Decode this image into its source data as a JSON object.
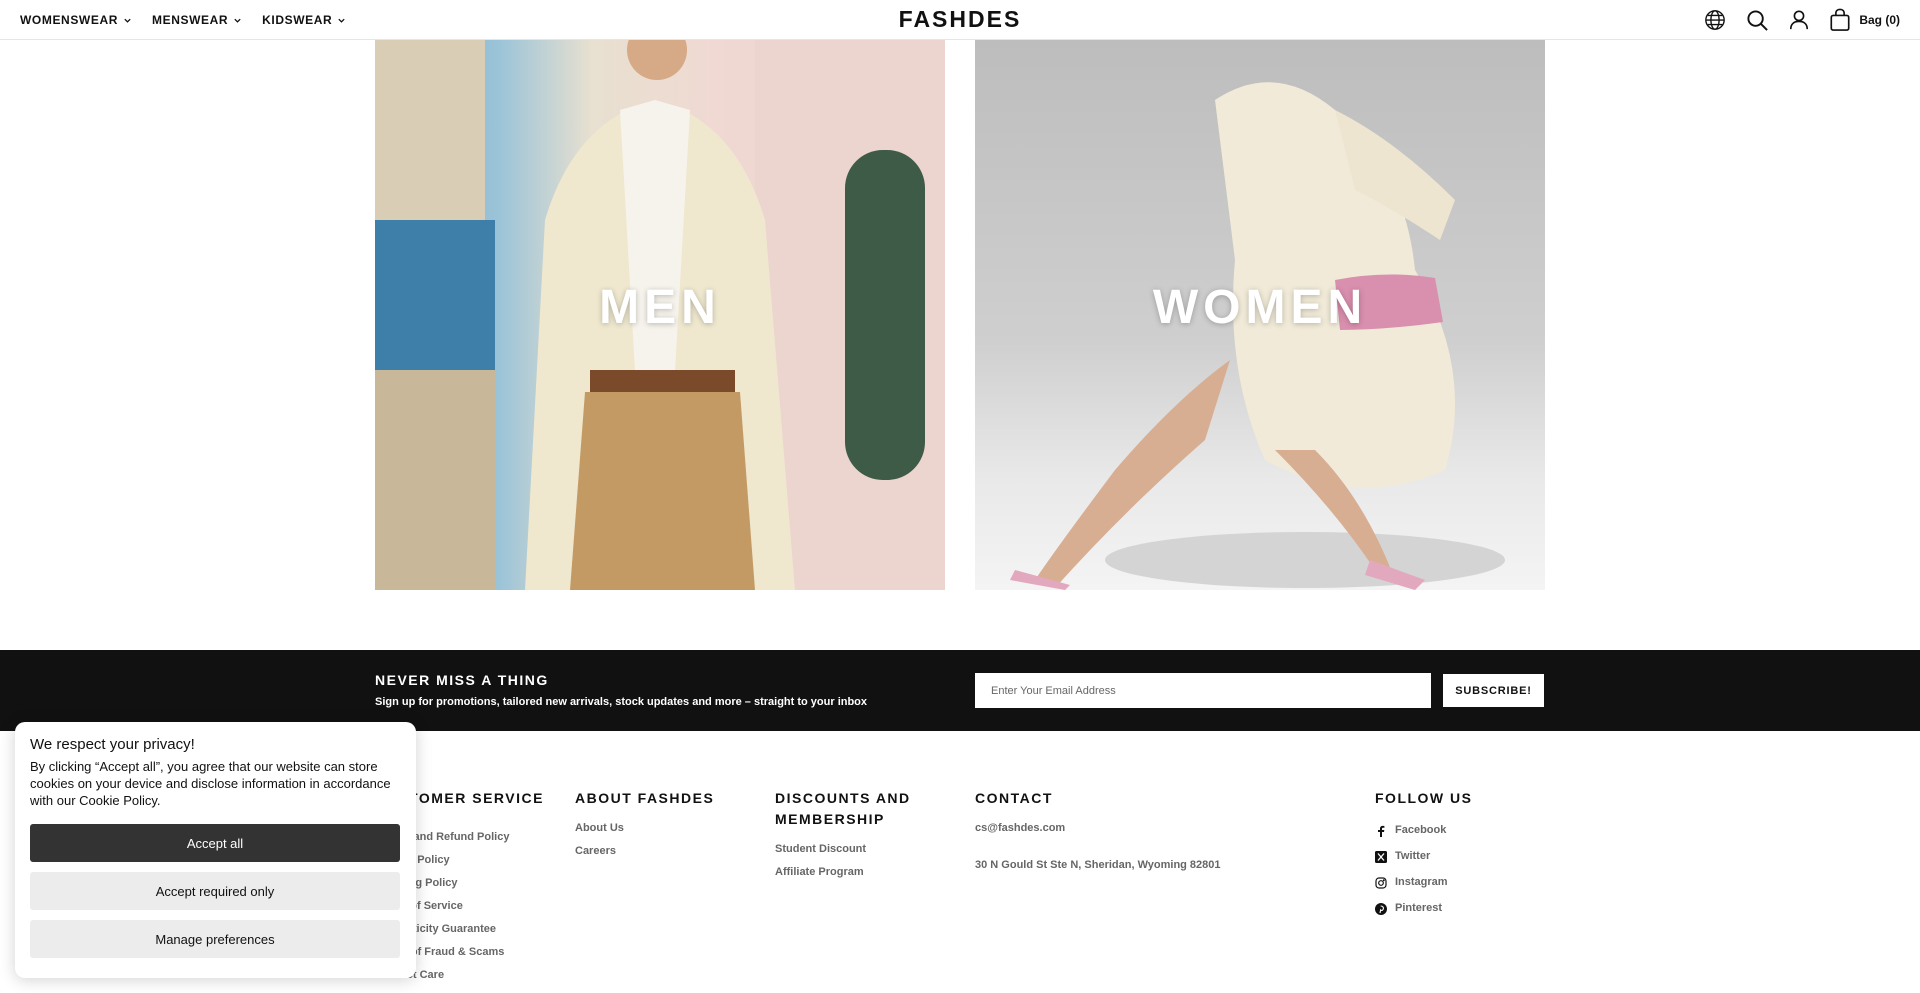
{
  "header": {
    "nav": [
      {
        "label": "WOMENSWEAR"
      },
      {
        "label": "MENSWEAR"
      },
      {
        "label": "KIDSWEAR"
      }
    ],
    "logo": "FASHDES",
    "bag_label": "Bag (0)",
    "icons": [
      "globe-icon",
      "search-icon",
      "account-icon",
      "bag-icon"
    ]
  },
  "hero": {
    "men_label": "MEN",
    "women_label": "WOMEN"
  },
  "newsletter": {
    "title": "NEVER MISS A THING",
    "subtitle": "Sign up for promotions, tailored new arrivals, stock updates and more – straight to your inbox",
    "email_placeholder": "Enter Your Email Address",
    "button_label": "SUBSCRIBE!"
  },
  "footer": {
    "customer_service": {
      "title": "CUSTOMER SERVICE",
      "links": [
        "Return and Refund Policy",
        "Privacy Policy",
        "Shipping Policy",
        "Terms of Service",
        "Authenticity Guarantee",
        "Aware of Fraud & Scams",
        "Product Care"
      ]
    },
    "about": {
      "title": "ABOUT FASHDES",
      "links": [
        "About Us",
        "Careers"
      ]
    },
    "discounts": {
      "title": "DISCOUNTS AND MEMBERSHIP",
      "links": [
        "Student Discount",
        "Affiliate Program"
      ]
    },
    "contact": {
      "title": "CONTACT",
      "email": "cs@fashdes.com",
      "address": "30 N Gould St Ste N, Sheridan, Wyoming 82801"
    },
    "follow": {
      "title": "FOLLOW US",
      "links": [
        {
          "label": "Facebook",
          "icon": "facebook-icon"
        },
        {
          "label": "Twitter",
          "icon": "x-twitter-icon"
        },
        {
          "label": "Instagram",
          "icon": "instagram-icon"
        },
        {
          "label": "Pinterest",
          "icon": "pinterest-icon"
        }
      ]
    }
  },
  "cookie": {
    "title": "We respect your privacy!",
    "text": "By clicking “Accept all”, you agree that our website can store cookies on your device and disclose information in accordance with our Cookie Policy.",
    "accept_all": "Accept all",
    "accept_required": "Accept required only",
    "manage": "Manage preferences"
  },
  "colors": {
    "text": "#111111",
    "muted": "#666666",
    "band": "#111111",
    "primary_button": "#333333",
    "secondary_button": "#ececec"
  }
}
